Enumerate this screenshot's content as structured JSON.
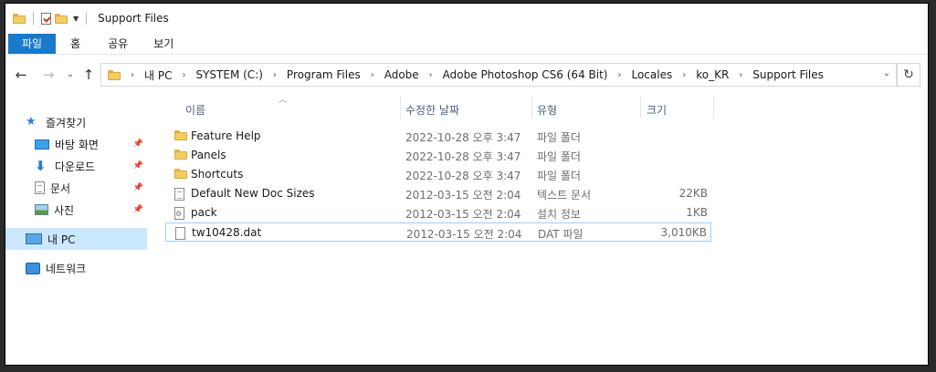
{
  "window": {
    "title": "Support Files"
  },
  "ribbon": {
    "tabs": [
      "파일",
      "홈",
      "공유",
      "보기"
    ]
  },
  "address": {
    "crumbs": [
      "내 PC",
      "SYSTEM (C:)",
      "Program Files",
      "Adobe",
      "Adobe Photoshop CS6 (64 Bit)",
      "Locales",
      "ko_KR",
      "Support Files"
    ]
  },
  "sidebar": {
    "items": [
      {
        "label": "즐겨찾기",
        "icon": "star-icon"
      },
      {
        "label": "바탕 화면",
        "icon": "desktop-icon",
        "pinned": true
      },
      {
        "label": "다운로드",
        "icon": "download-icon",
        "pinned": true
      },
      {
        "label": "문서",
        "icon": "document-icon",
        "pinned": true
      },
      {
        "label": "사진",
        "icon": "pictures-icon",
        "pinned": true
      },
      {
        "label": "내 PC",
        "icon": "pc-icon",
        "selected": true
      },
      {
        "label": "네트워크",
        "icon": "network-icon"
      }
    ]
  },
  "list": {
    "columns": {
      "name": "이름",
      "date": "수정한 날짜",
      "type": "유형",
      "size": "크기"
    },
    "rows": [
      {
        "name": "Feature Help",
        "date": "2022-10-28 오후 3:47",
        "type": "파일 폴더",
        "size": "",
        "icon": "folder-icon"
      },
      {
        "name": "Panels",
        "date": "2022-10-28 오후 3:47",
        "type": "파일 폴더",
        "size": "",
        "icon": "folder-icon"
      },
      {
        "name": "Shortcuts",
        "date": "2022-10-28 오후 3:47",
        "type": "파일 폴더",
        "size": "",
        "icon": "folder-icon"
      },
      {
        "name": "Default New Doc Sizes",
        "date": "2012-03-15 오전 2:04",
        "type": "텍스트 문서",
        "size": "22KB",
        "icon": "text-file-icon"
      },
      {
        "name": "pack",
        "date": "2012-03-15 오전 2:04",
        "type": "설치 정보",
        "size": "1KB",
        "icon": "setup-file-icon"
      },
      {
        "name": "tw10428.dat",
        "date": "2012-03-15 오전 2:04",
        "type": "DAT 파일",
        "size": "3,010KB",
        "icon": "file-icon",
        "selected": true
      }
    ]
  },
  "colors": {
    "file_tab": "#1979ca",
    "selection": "#cce8ff",
    "folder": "#f3cd63"
  }
}
